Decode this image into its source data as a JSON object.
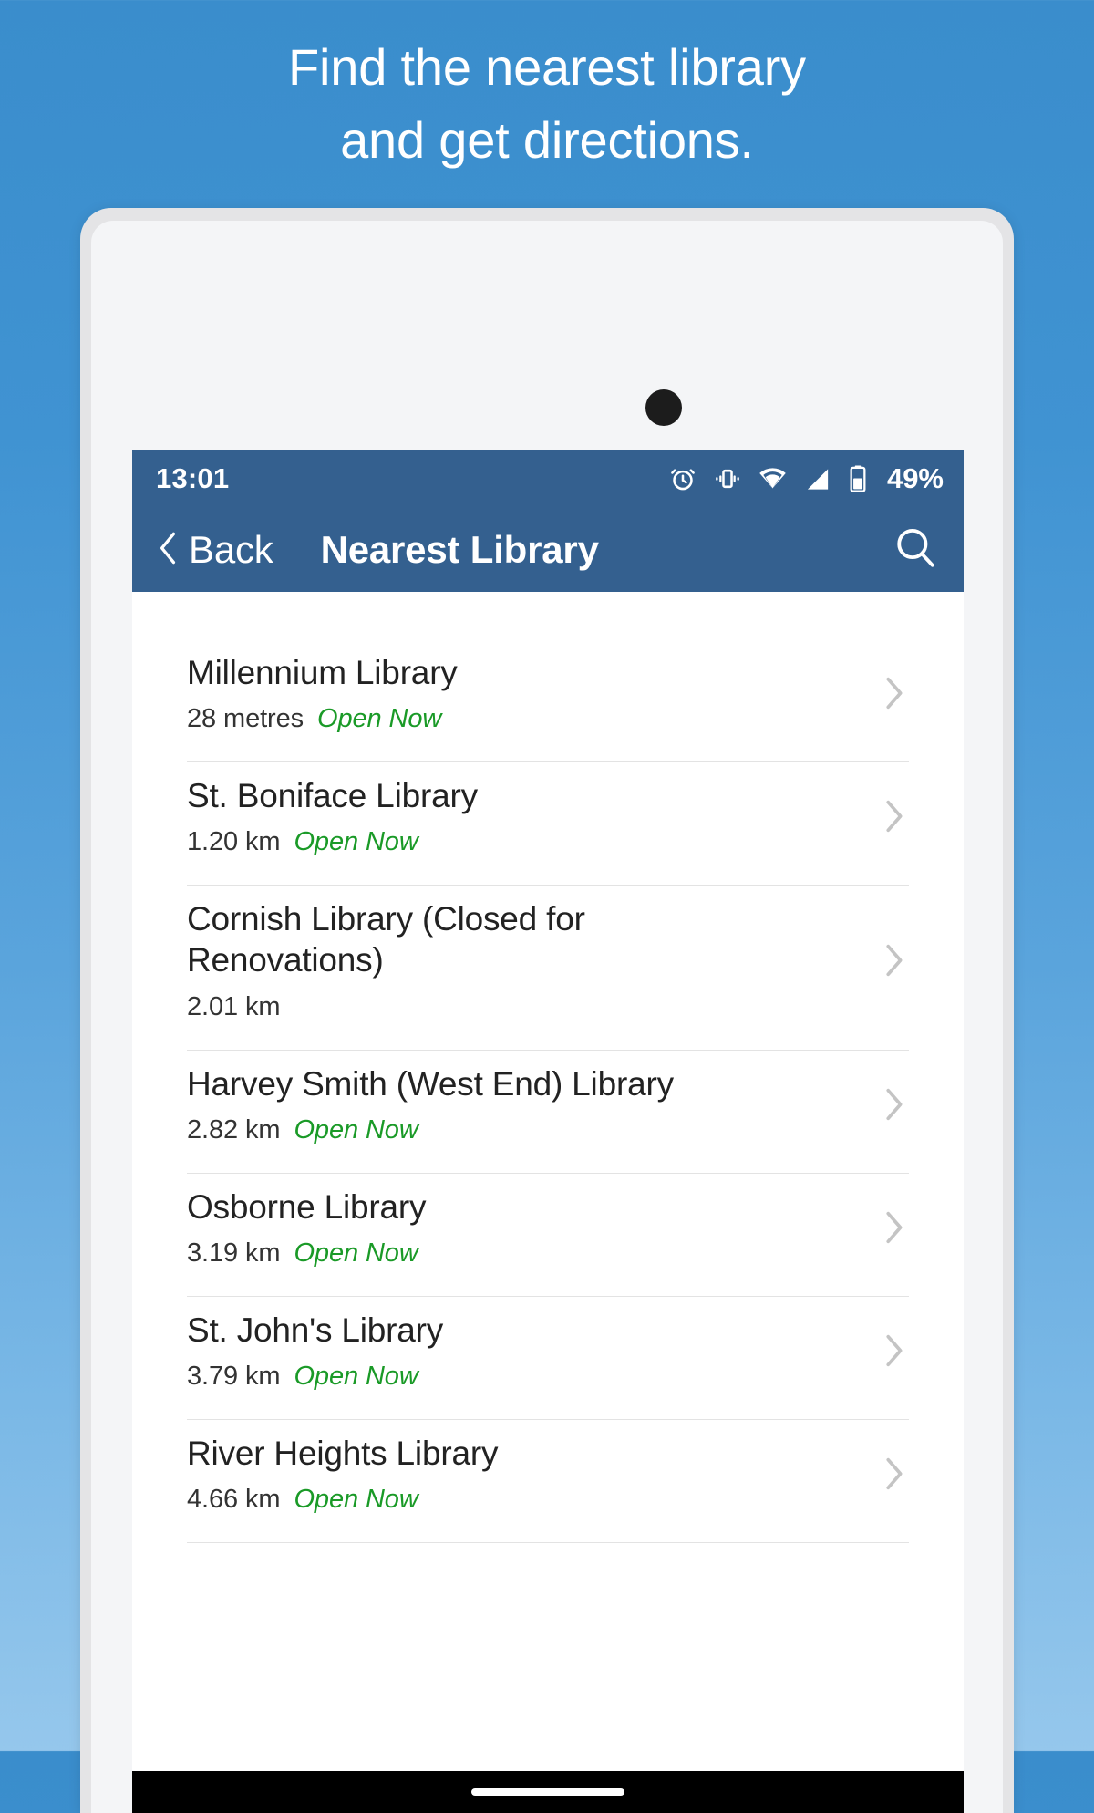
{
  "promo": {
    "headline_line1": "Find the nearest library",
    "headline_line2": "and get directions.",
    "background_top_color": "#3a8dcc",
    "background_bottom_color": "#95c7ec"
  },
  "device": {
    "bezel_color": "#e4e4e6",
    "body_color": "#f4f5f7",
    "camera_icon": "camera-dot"
  },
  "statusbar": {
    "time": "13:01",
    "battery_percent": "49%",
    "background_color": "#34608f",
    "icons": [
      "alarm-clock-icon",
      "vibrate-icon",
      "wifi-icon",
      "cellular-signal-icon",
      "battery-icon"
    ]
  },
  "navbar": {
    "back_label": "Back",
    "back_icon": "chevron-left-icon",
    "title": "Nearest Library",
    "search_icon": "search-icon",
    "background_color": "#34608f"
  },
  "list": {
    "open_status_color": "#1a9a27",
    "chevron_icon": "chevron-right-icon",
    "items": [
      {
        "name": "Millennium Library",
        "distance": "28 metres",
        "status": "Open Now"
      },
      {
        "name": "St. Boniface Library",
        "distance": "1.20 km",
        "status": "Open Now"
      },
      {
        "name": "Cornish Library (Closed for Renovations)",
        "distance": "2.01 km",
        "status": ""
      },
      {
        "name": "Harvey Smith (West End) Library",
        "distance": "2.82 km",
        "status": "Open Now"
      },
      {
        "name": "Osborne Library",
        "distance": "3.19 km",
        "status": "Open Now"
      },
      {
        "name": "St. John's Library",
        "distance": "3.79 km",
        "status": "Open Now"
      },
      {
        "name": "River Heights Library",
        "distance": "4.66 km",
        "status": "Open Now"
      }
    ]
  },
  "gesturebar": {
    "pill": "home-indicator"
  }
}
